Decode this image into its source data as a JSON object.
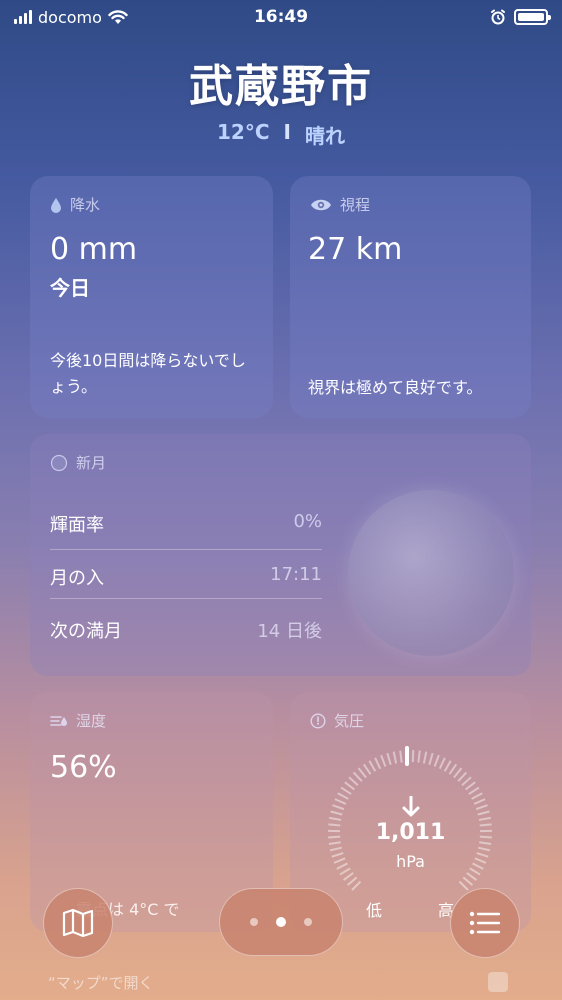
{
  "status_bar": {
    "carrier": "docomo",
    "time": "16:49"
  },
  "header": {
    "city": "武蔵野市",
    "temperature": "12°C",
    "separator": "I",
    "condition": "晴れ"
  },
  "precipitation": {
    "title": "降水",
    "value": "0 mm",
    "period": "今日",
    "description": "今後10日間は降らないでしょう。"
  },
  "visibility": {
    "title": "視程",
    "value": "27 km",
    "description": "視界は極めて良好です。"
  },
  "moon": {
    "title": "新月",
    "rows": [
      {
        "label": "輝面率",
        "value": "0%"
      },
      {
        "label": "月の入",
        "value": "17:11"
      },
      {
        "label": "次の満月",
        "value": "14 日後"
      }
    ]
  },
  "humidity": {
    "title": "湿度",
    "value": "56%",
    "description": "露点は 4°C で"
  },
  "pressure": {
    "title": "気圧",
    "value": "1,011",
    "unit": "hPa",
    "low_label": "低",
    "high_label": "高",
    "trend": "down"
  },
  "bottom": {
    "hint": "“マップ”で開く"
  },
  "colors": {
    "accent_blue": "#bcd3ff"
  }
}
